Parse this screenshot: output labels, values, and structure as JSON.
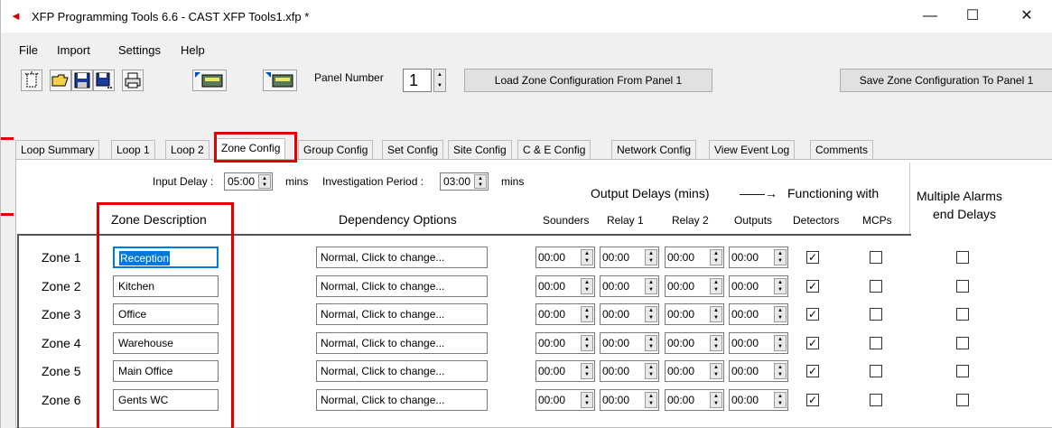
{
  "window": {
    "title": "XFP Programming Tools 6.6 - CAST XFP Tools1.xfp *",
    "minimize": "—",
    "maximize": "☐",
    "close": "✕"
  },
  "menu": [
    "File",
    "Import",
    "Settings",
    "Help"
  ],
  "toolbar": {
    "panel_label": "Panel  Number",
    "panel_number": "1",
    "load_button": "Load Zone Configuration From Panel 1",
    "save_button": "Save Zone Configuration To Panel 1"
  },
  "tabs": [
    "Loop Summary",
    "Loop 1",
    "Loop 2",
    "Zone Config",
    "Group Config",
    "Set Config",
    "Site Config",
    "C & E Config",
    "Network Config",
    "View Event Log",
    "Comments"
  ],
  "active_tab": "Zone Config",
  "settings": {
    "input_delay_label": "Input Delay :",
    "input_delay_value": "05:00",
    "mins1": "mins",
    "investigation_label": "Investigation Period :",
    "investigation_value": "03:00",
    "mins2": "mins"
  },
  "headers": {
    "output_delays": "Output Delays  (mins)",
    "functioning_with": "Functioning with",
    "multiple_alarms_1": "Multiple Alarms",
    "multiple_alarms_2": "end Delays",
    "zone_description": "Zone Description",
    "dependency_options": "Dependency Options",
    "sounders": "Sounders",
    "relay1": "Relay 1",
    "relay2": "Relay 2",
    "outputs": "Outputs",
    "detectors": "Detectors",
    "mcps": "MCPs"
  },
  "zones": [
    {
      "label": "Zone 1",
      "description": "Reception",
      "dependency": "Normal, Click to change...",
      "sounders": "00:00",
      "relay1": "00:00",
      "relay2": "00:00",
      "outputs": "00:00",
      "detectors": true,
      "mcps": false,
      "multiple": false
    },
    {
      "label": "Zone 2",
      "description": "Kitchen",
      "dependency": "Normal, Click to change...",
      "sounders": "00:00",
      "relay1": "00:00",
      "relay2": "00:00",
      "outputs": "00:00",
      "detectors": true,
      "mcps": false,
      "multiple": false
    },
    {
      "label": "Zone 3",
      "description": "Office",
      "dependency": "Normal, Click to change...",
      "sounders": "00:00",
      "relay1": "00:00",
      "relay2": "00:00",
      "outputs": "00:00",
      "detectors": true,
      "mcps": false,
      "multiple": false
    },
    {
      "label": "Zone 4",
      "description": "Warehouse",
      "dependency": "Normal, Click to change...",
      "sounders": "00:00",
      "relay1": "00:00",
      "relay2": "00:00",
      "outputs": "00:00",
      "detectors": true,
      "mcps": false,
      "multiple": false
    },
    {
      "label": "Zone 5",
      "description": "Main Office",
      "dependency": "Normal, Click to change...",
      "sounders": "00:00",
      "relay1": "00:00",
      "relay2": "00:00",
      "outputs": "00:00",
      "detectors": true,
      "mcps": false,
      "multiple": false
    },
    {
      "label": "Zone 6",
      "description": "Gents WC",
      "dependency": "Normal, Click to change...",
      "sounders": "00:00",
      "relay1": "00:00",
      "relay2": "00:00",
      "outputs": "00:00",
      "detectors": true,
      "mcps": false,
      "multiple": false
    }
  ],
  "colors": {
    "highlight": "#e00000",
    "selection": "#0078d7"
  },
  "icons": [
    "new-icon",
    "open-folder-icon",
    "save-icon",
    "save-as-icon",
    "print-icon",
    "read-panel-icon",
    "write-panel-icon"
  ]
}
